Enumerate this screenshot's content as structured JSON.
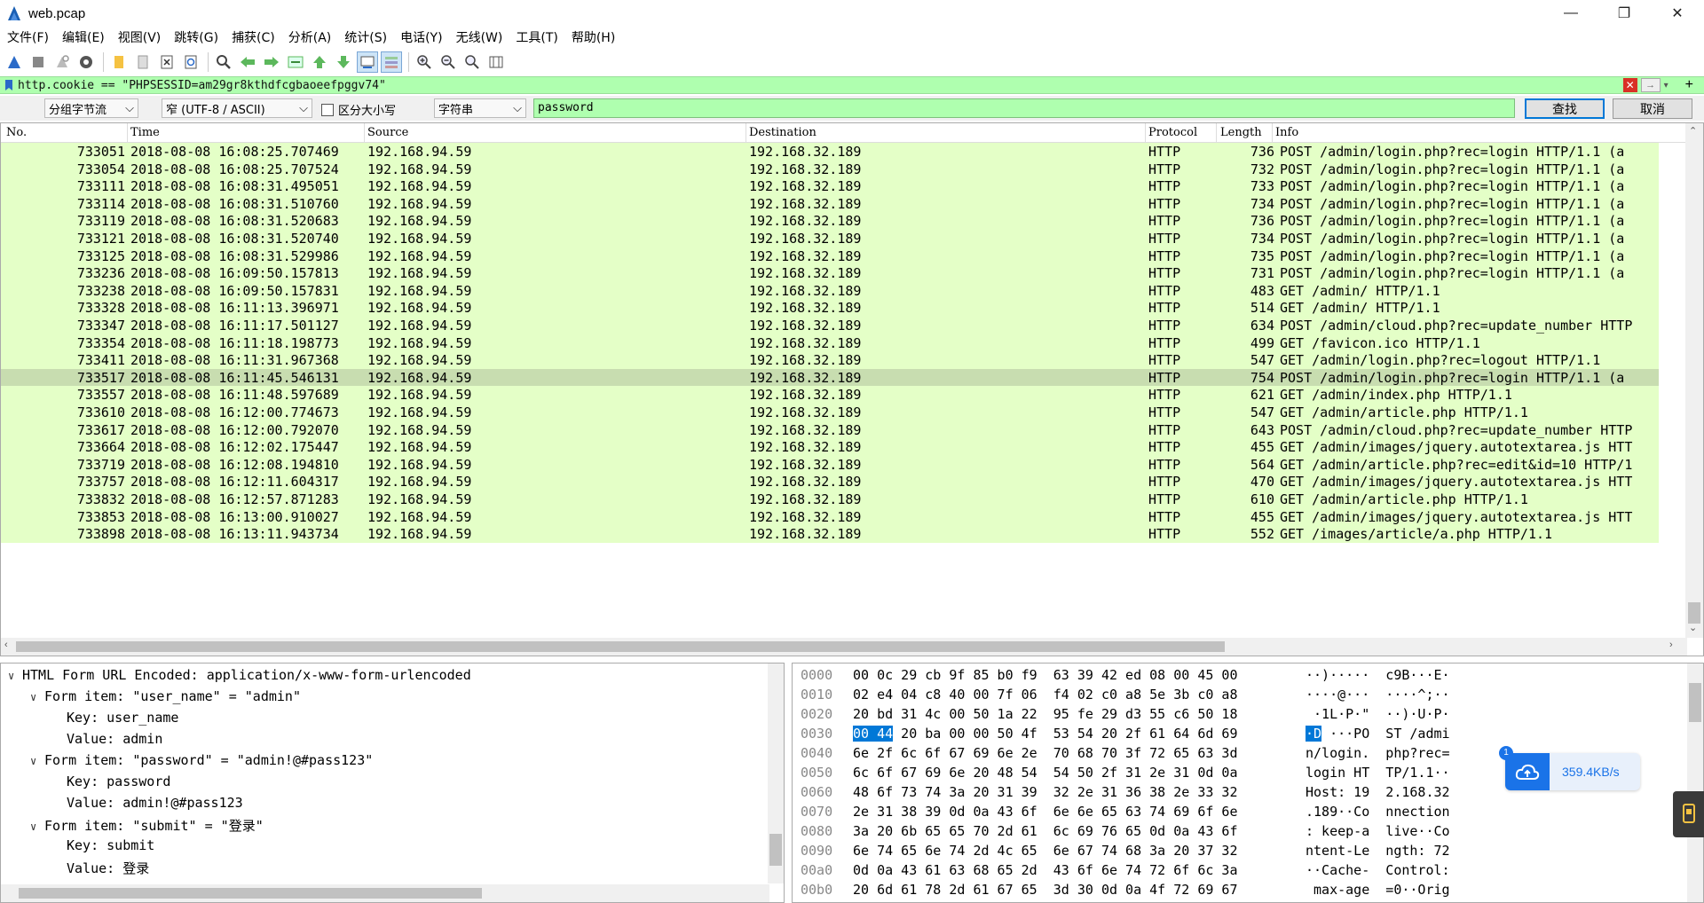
{
  "window": {
    "title": "web.pcap",
    "minimize": "—",
    "maximize": "❐",
    "close": "✕"
  },
  "menu": [
    "文件(F)",
    "编辑(E)",
    "视图(V)",
    "跳转(G)",
    "捕获(C)",
    "分析(A)",
    "统计(S)",
    "电话(Y)",
    "无线(W)",
    "工具(T)",
    "帮助(H)"
  ],
  "toolbar_icons": [
    "shark-fin-start-icon",
    "stop-icon",
    "restart-icon",
    "capture-options-icon",
    "open-file-icon",
    "save-file-icon",
    "close-file-icon",
    "reload-icon",
    "find-packet-icon",
    "go-back-icon",
    "go-forward-icon",
    "go-to-packet-icon",
    "go-first-icon",
    "go-last-icon",
    "autoscroll-icon",
    "colorize-icon",
    "zoom-in-icon",
    "zoom-out-icon",
    "zoom-reset-icon",
    "resize-columns-icon"
  ],
  "filter": {
    "text": "http.cookie == \"PHPSESSID=am29gr8kthdfcgbaoeefpggv74\"",
    "clear": "✕",
    "apply": "→",
    "dropdown": "▾",
    "add": "+"
  },
  "find": {
    "search_in": "分组字节流",
    "encoding": "窄 (UTF-8 / ASCII)",
    "case_label": "区分大小写",
    "type": "字符串",
    "value": "password",
    "find_button": "查找",
    "cancel_button": "取消"
  },
  "packet_list": {
    "columns": [
      "No.",
      "Time",
      "Source",
      "Destination",
      "Protocol",
      "Length",
      "Info"
    ],
    "selected_index": 13,
    "rows": [
      {
        "no": "733051",
        "time": "2018-08-08 16:08:25.707469",
        "src": "192.168.94.59",
        "dst": "192.168.32.189",
        "proto": "HTTP",
        "len": "736",
        "info": "POST /admin/login.php?rec=login HTTP/1.1  (a"
      },
      {
        "no": "733054",
        "time": "2018-08-08 16:08:25.707524",
        "src": "192.168.94.59",
        "dst": "192.168.32.189",
        "proto": "HTTP",
        "len": "732",
        "info": "POST /admin/login.php?rec=login HTTP/1.1  (a"
      },
      {
        "no": "733111",
        "time": "2018-08-08 16:08:31.495051",
        "src": "192.168.94.59",
        "dst": "192.168.32.189",
        "proto": "HTTP",
        "len": "733",
        "info": "POST /admin/login.php?rec=login HTTP/1.1  (a"
      },
      {
        "no": "733114",
        "time": "2018-08-08 16:08:31.510760",
        "src": "192.168.94.59",
        "dst": "192.168.32.189",
        "proto": "HTTP",
        "len": "734",
        "info": "POST /admin/login.php?rec=login HTTP/1.1  (a"
      },
      {
        "no": "733119",
        "time": "2018-08-08 16:08:31.520683",
        "src": "192.168.94.59",
        "dst": "192.168.32.189",
        "proto": "HTTP",
        "len": "736",
        "info": "POST /admin/login.php?rec=login HTTP/1.1  (a"
      },
      {
        "no": "733121",
        "time": "2018-08-08 16:08:31.520740",
        "src": "192.168.94.59",
        "dst": "192.168.32.189",
        "proto": "HTTP",
        "len": "734",
        "info": "POST /admin/login.php?rec=login HTTP/1.1  (a"
      },
      {
        "no": "733125",
        "time": "2018-08-08 16:08:31.529986",
        "src": "192.168.94.59",
        "dst": "192.168.32.189",
        "proto": "HTTP",
        "len": "735",
        "info": "POST /admin/login.php?rec=login HTTP/1.1  (a"
      },
      {
        "no": "733236",
        "time": "2018-08-08 16:09:50.157813",
        "src": "192.168.94.59",
        "dst": "192.168.32.189",
        "proto": "HTTP",
        "len": "731",
        "info": "POST /admin/login.php?rec=login HTTP/1.1  (a"
      },
      {
        "no": "733238",
        "time": "2018-08-08 16:09:50.157831",
        "src": "192.168.94.59",
        "dst": "192.168.32.189",
        "proto": "HTTP",
        "len": "483",
        "info": "GET /admin/ HTTP/1.1"
      },
      {
        "no": "733328",
        "time": "2018-08-08 16:11:13.396971",
        "src": "192.168.94.59",
        "dst": "192.168.32.189",
        "proto": "HTTP",
        "len": "514",
        "info": "GET /admin/ HTTP/1.1"
      },
      {
        "no": "733347",
        "time": "2018-08-08 16:11:17.501127",
        "src": "192.168.94.59",
        "dst": "192.168.32.189",
        "proto": "HTTP",
        "len": "634",
        "info": "POST /admin/cloud.php?rec=update_number HTTP"
      },
      {
        "no": "733354",
        "time": "2018-08-08 16:11:18.198773",
        "src": "192.168.94.59",
        "dst": "192.168.32.189",
        "proto": "HTTP",
        "len": "499",
        "info": "GET /favicon.ico HTTP/1.1"
      },
      {
        "no": "733411",
        "time": "2018-08-08 16:11:31.967368",
        "src": "192.168.94.59",
        "dst": "192.168.32.189",
        "proto": "HTTP",
        "len": "547",
        "info": "GET /admin/login.php?rec=logout HTTP/1.1"
      },
      {
        "no": "733517",
        "time": "2018-08-08 16:11:45.546131",
        "src": "192.168.94.59",
        "dst": "192.168.32.189",
        "proto": "HTTP",
        "len": "754",
        "info": "POST /admin/login.php?rec=login HTTP/1.1  (a"
      },
      {
        "no": "733557",
        "time": "2018-08-08 16:11:48.597689",
        "src": "192.168.94.59",
        "dst": "192.168.32.189",
        "proto": "HTTP",
        "len": "621",
        "info": "GET /admin/index.php HTTP/1.1"
      },
      {
        "no": "733610",
        "time": "2018-08-08 16:12:00.774673",
        "src": "192.168.94.59",
        "dst": "192.168.32.189",
        "proto": "HTTP",
        "len": "547",
        "info": "GET /admin/article.php HTTP/1.1"
      },
      {
        "no": "733617",
        "time": "2018-08-08 16:12:00.792070",
        "src": "192.168.94.59",
        "dst": "192.168.32.189",
        "proto": "HTTP",
        "len": "643",
        "info": "POST /admin/cloud.php?rec=update_number HTTP"
      },
      {
        "no": "733664",
        "time": "2018-08-08 16:12:02.175447",
        "src": "192.168.94.59",
        "dst": "192.168.32.189",
        "proto": "HTTP",
        "len": "455",
        "info": "GET /admin/images/jquery.autotextarea.js HTT"
      },
      {
        "no": "733719",
        "time": "2018-08-08 16:12:08.194810",
        "src": "192.168.94.59",
        "dst": "192.168.32.189",
        "proto": "HTTP",
        "len": "564",
        "info": "GET /admin/article.php?rec=edit&id=10 HTTP/1"
      },
      {
        "no": "733757",
        "time": "2018-08-08 16:12:11.604317",
        "src": "192.168.94.59",
        "dst": "192.168.32.189",
        "proto": "HTTP",
        "len": "470",
        "info": "GET /admin/images/jquery.autotextarea.js HTT"
      },
      {
        "no": "733832",
        "time": "2018-08-08 16:12:57.871283",
        "src": "192.168.94.59",
        "dst": "192.168.32.189",
        "proto": "HTTP",
        "len": "610",
        "info": "GET /admin/article.php HTTP/1.1"
      },
      {
        "no": "733853",
        "time": "2018-08-08 16:13:00.910027",
        "src": "192.168.94.59",
        "dst": "192.168.32.189",
        "proto": "HTTP",
        "len": "455",
        "info": "GET /admin/images/jquery.autotextarea.js HTT"
      },
      {
        "no": "733898",
        "time": "2018-08-08 16:13:11.943734",
        "src": "192.168.94.59",
        "dst": "192.168.32.189",
        "proto": "HTTP",
        "len": "552",
        "info": "GET /images/article/a.php HTTP/1.1"
      }
    ]
  },
  "details": {
    "rows": [
      {
        "arrow": "∨",
        "text": "HTML Form URL Encoded: application/x-www-form-urlencoded",
        "level": 0
      },
      {
        "arrow": "∨",
        "text": "Form item: \"user_name\" = \"admin\"",
        "level": 1
      },
      {
        "arrow": "",
        "text": "Key: user_name",
        "level": 2
      },
      {
        "arrow": "",
        "text": "Value: admin",
        "level": 2
      },
      {
        "arrow": "∨",
        "text": "Form item: \"password\" = \"admin!@#pass123\"",
        "level": 1
      },
      {
        "arrow": "",
        "text": "Key: password",
        "level": 2
      },
      {
        "arrow": "",
        "text": "Value: admin!@#pass123",
        "level": 2
      },
      {
        "arrow": "∨",
        "text": "Form item: \"submit\" = \"登录\"",
        "level": 1
      },
      {
        "arrow": "",
        "text": "Key: submit",
        "level": 2
      },
      {
        "arrow": "",
        "text": "Value: 登录",
        "level": 2
      }
    ]
  },
  "bytes": {
    "rows": [
      {
        "offset": "0000",
        "hex": "00 0c 29 cb 9f 85 b0 f9  63 39 42 ed 08 00 45 00",
        "ascii": "··)·····  c9B···E·"
      },
      {
        "offset": "0010",
        "hex": "02 e4 04 c8 40 00 7f 06  f4 02 c0 a8 5e 3b c0 a8",
        "ascii": "····@···  ····^;··"
      },
      {
        "offset": "0020",
        "hex": "20 bd 31 4c 00 50 1a 22  95 fe 29 d3 55 c6 50 18",
        "ascii": " ·1L·P·\"  ··)·U·P·"
      },
      {
        "offset": "0030",
        "hex_hl": "00 44",
        "hex": " 20 ba 00 00 50 4f  53 54 20 2f 61 64 6d 69",
        "ascii_hl": "·D",
        "ascii": " ···PO  ST /admi"
      },
      {
        "offset": "0040",
        "hex": "6e 2f 6c 6f 67 69 6e 2e  70 68 70 3f 72 65 63 3d",
        "ascii": "n/login.  php?rec="
      },
      {
        "offset": "0050",
        "hex": "6c 6f 67 69 6e 20 48 54  54 50 2f 31 2e 31 0d 0a",
        "ascii": "login HT  TP/1.1··"
      },
      {
        "offset": "0060",
        "hex": "48 6f 73 74 3a 20 31 39  32 2e 31 36 38 2e 33 32",
        "ascii": "Host: 19  2.168.32"
      },
      {
        "offset": "0070",
        "hex": "2e 31 38 39 0d 0a 43 6f  6e 6e 65 63 74 69 6f 6e",
        "ascii": ".189··Co  nnection"
      },
      {
        "offset": "0080",
        "hex": "3a 20 6b 65 65 70 2d 61  6c 69 76 65 0d 0a 43 6f",
        "ascii": ": keep-a  live··Co"
      },
      {
        "offset": "0090",
        "hex": "6e 74 65 6e 74 2d 4c 65  6e 67 74 68 3a 20 37 32",
        "ascii": "ntent-Le  ngth: 72"
      },
      {
        "offset": "00a0",
        "hex": "0d 0a 43 61 63 68 65 2d  43 6f 6e 74 72 6f 6c 3a",
        "ascii": "··Cache-  Control:"
      },
      {
        "offset": "00b0",
        "hex": "20 6d 61 78 2d 61 67 65  3d 30 0d 0a 4f 72 69 67",
        "ascii": " max-age  =0··Orig"
      }
    ]
  },
  "speed_widget": {
    "badge": "1",
    "rate": "359.4KB/s"
  },
  "colors": {
    "filter_bg": "#afffaf",
    "row_bg": "#e4ffc7",
    "row_selected_bg": "#c8ddb0",
    "accent": "#0078d7"
  }
}
